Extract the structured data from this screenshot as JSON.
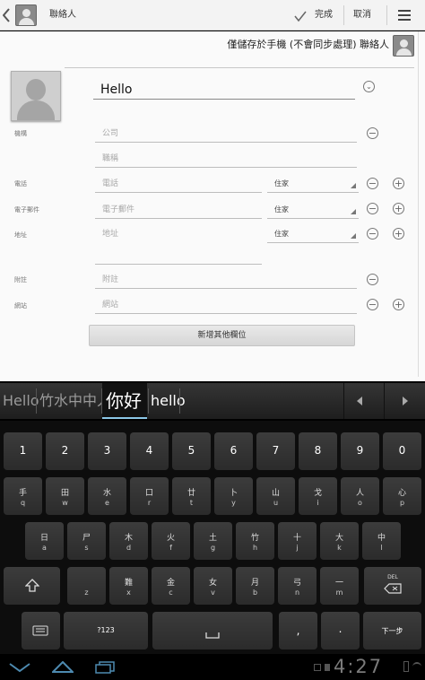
{
  "actionbar": {
    "title": "聯絡人",
    "done_label": "完成",
    "cancel_label": "取消"
  },
  "account": {
    "label": "僅儲存於手機 (不會同步處理) 聯絡人"
  },
  "name": {
    "value": "Hello"
  },
  "org": {
    "label": "機構",
    "company_placeholder": "公司",
    "title_placeholder": "職稱"
  },
  "phone": {
    "label": "電話",
    "placeholder": "電話",
    "type": "住家"
  },
  "email": {
    "label": "電子郵件",
    "placeholder": "電子郵件",
    "type": "住家"
  },
  "address": {
    "label": "地址",
    "placeholder": "地址",
    "type": "住家"
  },
  "notes": {
    "label": "附註",
    "placeholder": "附註"
  },
  "website": {
    "label": "網站",
    "placeholder": "網站"
  },
  "add_field_label": "新增其他欄位",
  "candidates": [
    "Hello",
    "竹水中中人",
    "你好",
    "hello"
  ],
  "keyboard": {
    "row1": [
      "1",
      "2",
      "3",
      "4",
      "5",
      "6",
      "7",
      "8",
      "9",
      "0"
    ],
    "row2": [
      {
        "top": "手",
        "bot": "q"
      },
      {
        "top": "田",
        "bot": "w"
      },
      {
        "top": "水",
        "bot": "e"
      },
      {
        "top": "口",
        "bot": "r"
      },
      {
        "top": "廿",
        "bot": "t"
      },
      {
        "top": "卜",
        "bot": "y"
      },
      {
        "top": "山",
        "bot": "u"
      },
      {
        "top": "戈",
        "bot": "i"
      },
      {
        "top": "人",
        "bot": "o"
      },
      {
        "top": "心",
        "bot": "p"
      }
    ],
    "row3": [
      {
        "top": "日",
        "bot": "a"
      },
      {
        "top": "尸",
        "bot": "s"
      },
      {
        "top": "木",
        "bot": "d"
      },
      {
        "top": "火",
        "bot": "f"
      },
      {
        "top": "土",
        "bot": "g"
      },
      {
        "top": "竹",
        "bot": "h"
      },
      {
        "top": "十",
        "bot": "j"
      },
      {
        "top": "大",
        "bot": "k"
      },
      {
        "top": "中",
        "bot": "l"
      }
    ],
    "row4": [
      {
        "top": "",
        "bot": "z"
      },
      {
        "top": "難",
        "bot": "x"
      },
      {
        "top": "金",
        "bot": "c"
      },
      {
        "top": "女",
        "bot": "v"
      },
      {
        "top": "月",
        "bot": "b"
      },
      {
        "top": "弓",
        "bot": "n"
      },
      {
        "top": "一",
        "bot": "m"
      }
    ],
    "del_label": "DEL",
    "sym_label": "?123",
    "next_label": "下一步"
  },
  "status": {
    "time": "4:27"
  }
}
